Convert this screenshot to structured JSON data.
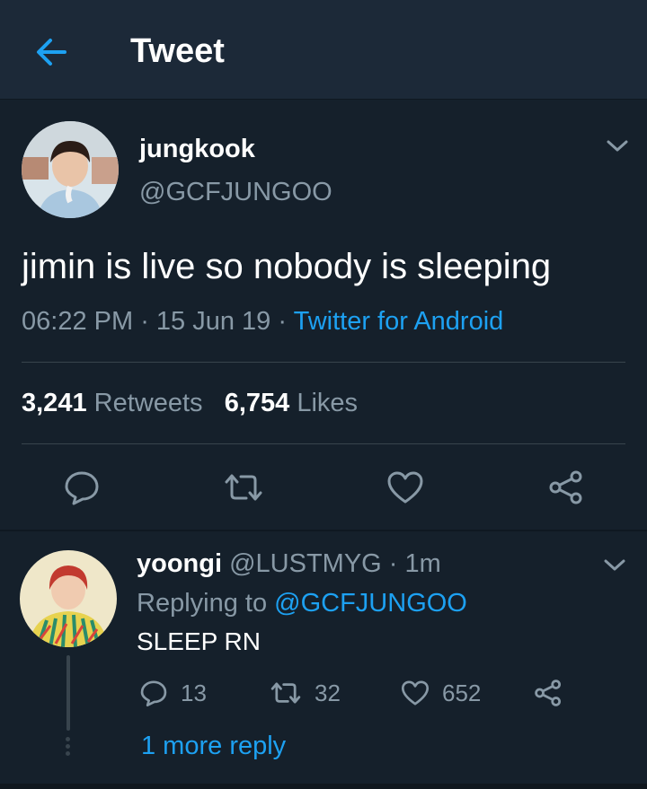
{
  "header": {
    "title": "Tweet",
    "back_icon": "arrow-left-icon",
    "accent": "#1da1f2"
  },
  "tweet": {
    "display_name": "jungkook",
    "handle": "@GCFJUNGOO",
    "text": "jimin is live so nobody is sleeping",
    "time": "06:22 PM",
    "date": "15 Jun 19",
    "client": "Twitter for Android",
    "retweets_count": "3,241",
    "retweets_label": "Retweets",
    "likes_count": "6,754",
    "likes_label": "Likes",
    "actions": [
      "reply-icon",
      "retweet-icon",
      "heart-icon",
      "share-icon"
    ]
  },
  "reply": {
    "display_name": "yoongi",
    "handle": "@LUSTMYG",
    "time": "1m",
    "replying_prefix": "Replying to",
    "replying_to": "@GCFJUNGOO",
    "text": "SLEEP RN",
    "reply_count": "13",
    "retweet_count": "32",
    "like_count": "652",
    "more_replies": "1 more reply"
  },
  "colors": {
    "background": "#15202b",
    "header_bg": "#1c2938",
    "secondary_text": "#8899a6",
    "link": "#1da1f2",
    "divider": "#38444d"
  }
}
